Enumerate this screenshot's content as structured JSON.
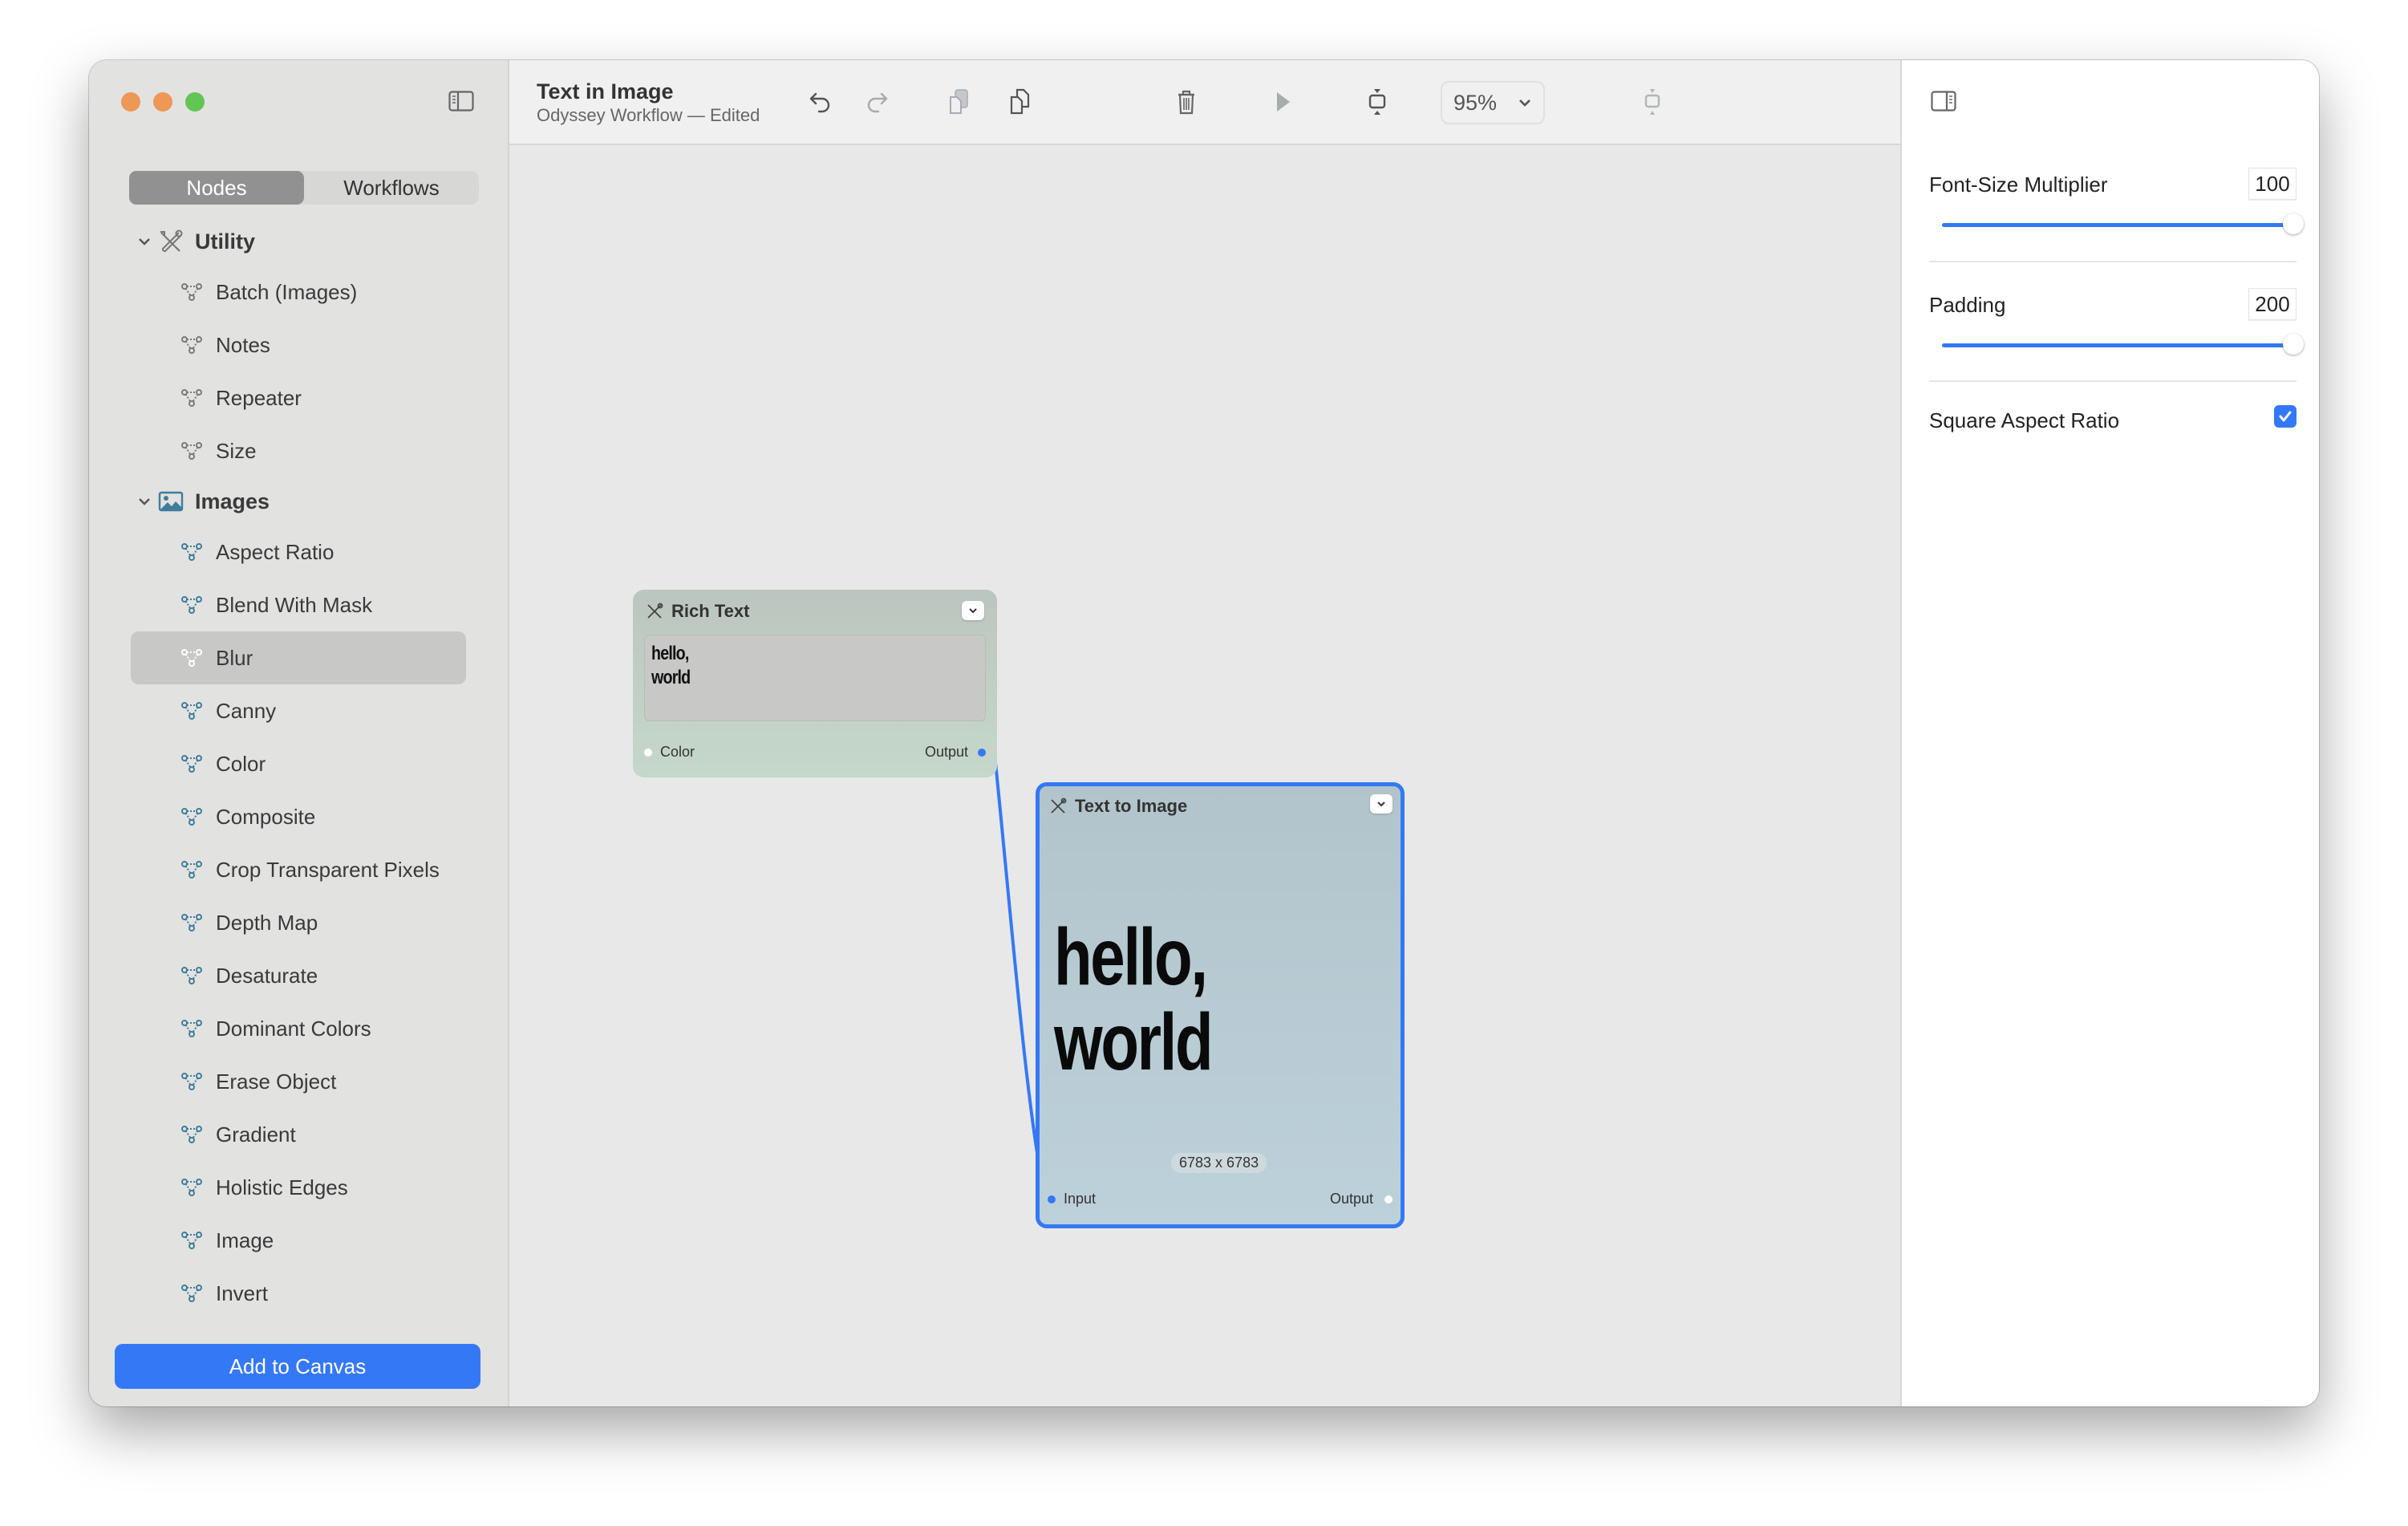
{
  "window": {
    "traffic_lights": {
      "close": "#ee9757",
      "minimize": "#ee9757",
      "zoom": "#62c554"
    }
  },
  "sidebar": {
    "tabs": [
      {
        "label": "Nodes",
        "active": true
      },
      {
        "label": "Workflows",
        "active": false
      }
    ],
    "groups": [
      {
        "label": "Utility",
        "icon": "tools-icon",
        "expanded": true,
        "items": [
          {
            "label": "Batch (Images)"
          },
          {
            "label": "Notes"
          },
          {
            "label": "Repeater"
          },
          {
            "label": "Size"
          }
        ]
      },
      {
        "label": "Images",
        "icon": "photo-icon",
        "expanded": true,
        "items": [
          {
            "label": "Aspect Ratio"
          },
          {
            "label": "Blend With Mask"
          },
          {
            "label": "Blur",
            "selected": true
          },
          {
            "label": "Canny"
          },
          {
            "label": "Color"
          },
          {
            "label": "Composite"
          },
          {
            "label": "Crop Transparent Pixels"
          },
          {
            "label": "Depth Map"
          },
          {
            "label": "Desaturate"
          },
          {
            "label": "Dominant Colors"
          },
          {
            "label": "Erase Object"
          },
          {
            "label": "Gradient"
          },
          {
            "label": "Holistic Edges"
          },
          {
            "label": "Image"
          },
          {
            "label": "Invert"
          }
        ]
      }
    ],
    "add_button": "Add to Canvas"
  },
  "toolbar": {
    "title": "Text in Image",
    "subtitle": "Odyssey Workflow — Edited",
    "zoom_level": "95%",
    "icons": [
      "undo-icon",
      "redo-icon",
      "copy-icon",
      "paste-icon",
      "trash-icon",
      "run-icon",
      "fit-height-icon",
      "fit-width-icon",
      "expand-icon"
    ]
  },
  "canvas": {
    "nodes": [
      {
        "title": "Rich Text",
        "content_text": "hello,\nworld",
        "inputs": [
          "Color"
        ],
        "outputs": [
          "Output"
        ]
      },
      {
        "title": "Text to Image",
        "selected": true,
        "preview_text": "hello,\nworld",
        "dimensions": "6783 x 6783",
        "inputs": [
          "Input"
        ],
        "outputs": [
          "Output"
        ]
      }
    ]
  },
  "inspector": {
    "fields": [
      {
        "label": "Font-Size Multiplier",
        "value": "100",
        "slider_fraction": 1.0
      },
      {
        "label": "Padding",
        "value": "200",
        "slider_fraction": 1.0
      }
    ],
    "square_aspect_ratio": {
      "label": "Square Aspect Ratio",
      "checked": true
    }
  },
  "colors": {
    "accent": "#3478f6",
    "utility_icon": "#7a7a7a",
    "images_icon": "#3f7d9b"
  }
}
